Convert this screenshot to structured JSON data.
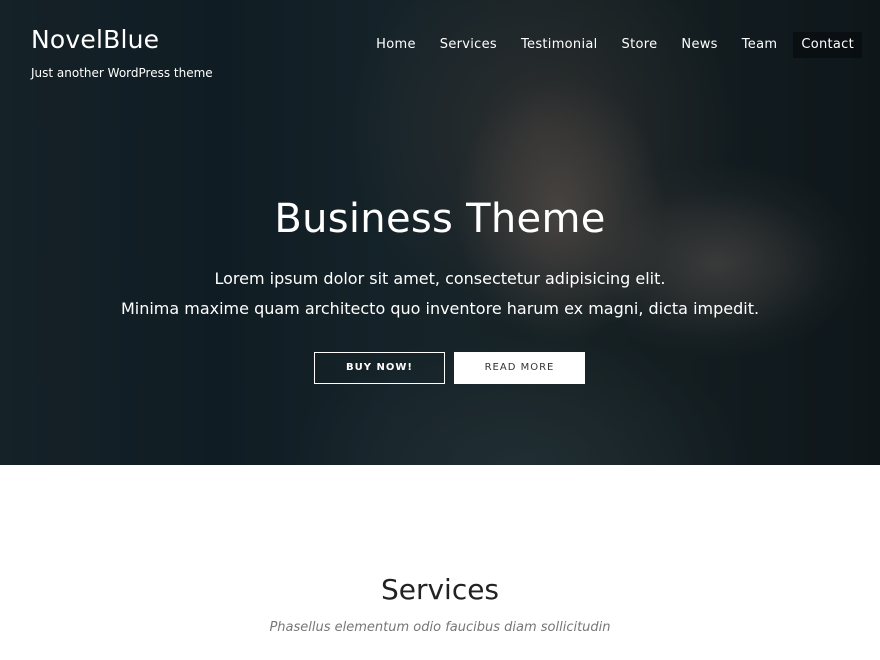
{
  "site": {
    "name": "NovelBlue",
    "tagline": "Just another WordPress theme"
  },
  "nav": {
    "items": [
      "Home",
      "Services",
      "Testimonial",
      "Store",
      "News",
      "Team",
      "Contact"
    ],
    "active": "Contact"
  },
  "hero": {
    "title": "Business Theme",
    "line1": "Lorem ipsum dolor sit amet, consectetur adipisicing elit.",
    "line2": "Minima maxime quam architecto quo inventore harum ex magni, dicta impedit.",
    "buy_label": "BUY NOW!",
    "read_label": "READ MORE"
  },
  "services": {
    "title": "Services",
    "subtitle": "Phasellus elementum odio faucibus diam sollicitudin"
  }
}
